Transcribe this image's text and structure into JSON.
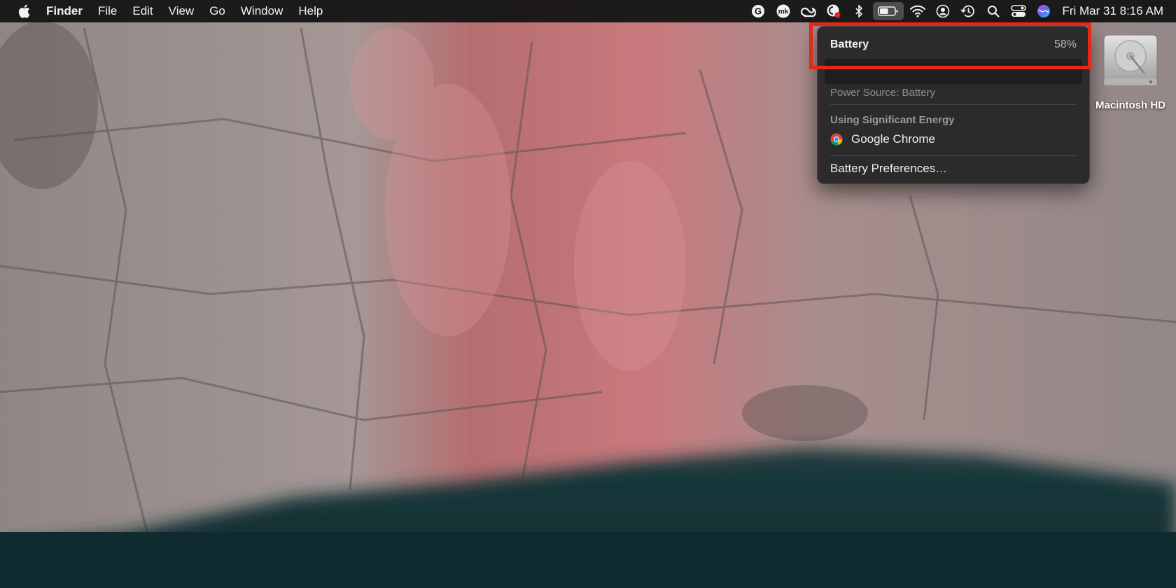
{
  "menubar": {
    "apple_icon": "apple-icon",
    "app_name": "Finder",
    "menus": [
      "File",
      "Edit",
      "View",
      "Go",
      "Window",
      "Help"
    ],
    "status_icons": [
      "grammarly-icon",
      "mk-icon",
      "creative-cloud-icon",
      "chat-badge-icon",
      "bluetooth-icon",
      "battery-icon",
      "wifi-icon",
      "user-icon",
      "time-machine-icon",
      "search-icon",
      "control-center-icon",
      "siri-icon"
    ],
    "clock": "Fri Mar 31  8:16 AM"
  },
  "battery_menu": {
    "title": "Battery",
    "percent": "58%",
    "power_source": "Power Source: Battery",
    "section_label": "Using Significant Energy",
    "apps": [
      {
        "name": "Google Chrome",
        "icon": "chrome-icon"
      }
    ],
    "preferences": "Battery Preferences…"
  },
  "battery_level": 58,
  "desktop": {
    "disk_label": "Macintosh HD"
  },
  "colors": {
    "highlight": "#e8261a",
    "menubar_bg": "#161616",
    "menu_bg": "#282828"
  }
}
